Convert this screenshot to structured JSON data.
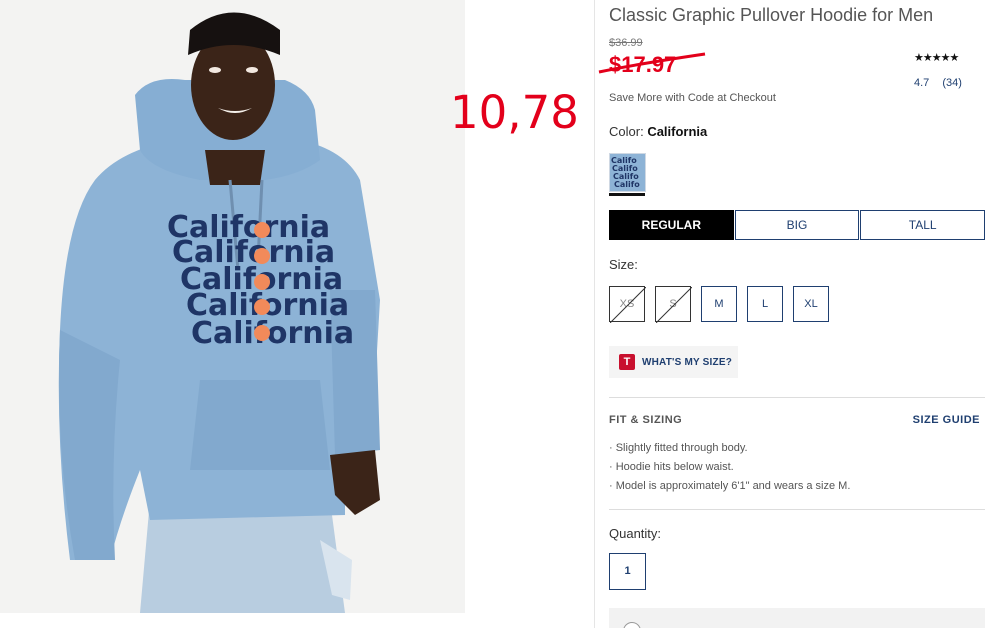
{
  "product": {
    "title": "Classic Graphic Pullover Hoodie for Men",
    "original_price": "$36.99",
    "sale_price": "$17.97",
    "promo_overlay_price": "10,78",
    "save_note": "Save More with Code at Checkout",
    "rating_stars": "★★★★★",
    "rating_value": "4.7",
    "review_count": "(34)",
    "graphic_text": "California"
  },
  "color": {
    "label": "Color:",
    "selected": "California"
  },
  "fit_tabs": [
    {
      "label": "REGULAR",
      "active": true
    },
    {
      "label": "BIG",
      "active": false
    },
    {
      "label": "TALL",
      "active": false
    }
  ],
  "size": {
    "label": "Size:",
    "options": [
      {
        "label": "XS",
        "available": false
      },
      {
        "label": "S",
        "available": false
      },
      {
        "label": "M",
        "available": true
      },
      {
        "label": "L",
        "available": true
      },
      {
        "label": "XL",
        "available": true
      }
    ]
  },
  "whats_my_size": {
    "icon_letter": "T",
    "label": "WHAT'S MY SIZE?"
  },
  "fit_sizing": {
    "title": "FIT & SIZING",
    "guide_link": "SIZE GUIDE",
    "items": [
      "· Slightly fitted through body.",
      "· Hoodie hits below waist.",
      "· Model is approximately 6'1\" and wears a size M."
    ]
  },
  "quantity": {
    "label": "Quantity:",
    "value": "1"
  },
  "colors": {
    "sale_red": "#e3001b",
    "navy": "#1f3f70",
    "hoodie_blue": "#8db3d6"
  }
}
